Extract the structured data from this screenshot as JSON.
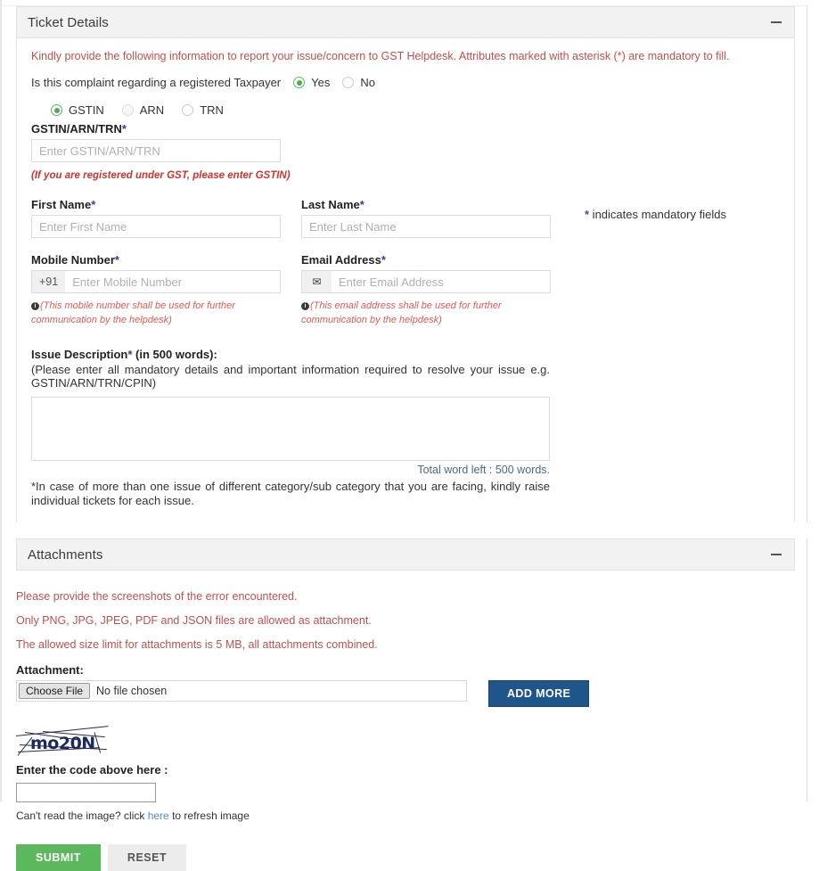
{
  "panels": {
    "ticket": {
      "title": "Ticket Details",
      "collapse_icon": "minus-icon",
      "intro": "Kindly provide the following information to report your issue/concern to GST Helpdesk. Attributes marked with asterisk (*) are mandatory to fill.",
      "registered_question": "Is this complaint regarding a registered Taxpayer",
      "registered_options": [
        {
          "label": "Yes",
          "checked": true
        },
        {
          "label": "No",
          "checked": false
        }
      ],
      "id_type_options": [
        {
          "label": "GSTIN",
          "checked": true,
          "dim": false
        },
        {
          "label": "ARN",
          "checked": false,
          "dim": true
        },
        {
          "label": "TRN",
          "checked": false,
          "dim": false
        }
      ],
      "gstin": {
        "label": "GSTIN/ARN/TRN",
        "asterisk": "*",
        "placeholder": "Enter GSTIN/ARN/TRN",
        "value": "",
        "hint": "(If you are registered under GST, please enter GSTIN)"
      },
      "first_name": {
        "label": "First Name",
        "asterisk": "*",
        "placeholder": "Enter First Name",
        "value": ""
      },
      "last_name": {
        "label": "Last Name",
        "asterisk": "*",
        "placeholder": "Enter Last Name",
        "value": ""
      },
      "mobile": {
        "label": "Mobile Number",
        "asterisk": "*",
        "prefix": "+91",
        "placeholder": "Enter Mobile Number",
        "value": "",
        "hint": "(This mobile number shall be used for further communication by the helpdesk)"
      },
      "email": {
        "label": "Email Address",
        "asterisk": "*",
        "icon": "envelope-icon",
        "placeholder": "Enter Email Address",
        "value": "",
        "hint": "(This email address shall be used for further communication by the helpdesk)"
      },
      "issue": {
        "label": "Issue Description",
        "asterisk": "*",
        "label_suffix": " (in 500 words):",
        "sub_text": "(Please enter all mandatory details and important information required to resolve your issue e.g. GSTIN/ARN/TRN/CPIN)",
        "value": "",
        "placeholder": "",
        "word_left": "Total word left : 500 words.",
        "footnote": "*In case of more than one issue of different category/sub category that you are facing, kindly raise individual tickets for each issue."
      },
      "mandatory_note_asterisk": "*",
      "mandatory_note": " indicates mandatory fields"
    },
    "attachments": {
      "title": "Attachments",
      "collapse_icon": "minus-icon",
      "lines": [
        "Please provide the screenshots of the error encountered.",
        "Only PNG, JPG, JPEG, PDF and JSON files are allowed as attachment.",
        "The allowed size limit for attachments is 5 MB, all attachments combined."
      ],
      "attachment_label": "Attachment:",
      "choose_file_button": "Choose File",
      "file_status": "No file chosen",
      "add_more_button": "ADD MORE"
    }
  },
  "captcha": {
    "image_text": "mo20N",
    "label": "Enter the code above here :",
    "input_value": "",
    "input_placeholder": "",
    "refresh_prefix": "Can't read the image? click ",
    "refresh_link": "here",
    "refresh_suffix": " to refresh image"
  },
  "actions": {
    "submit": "SUBMIT",
    "reset": "RESET"
  },
  "colors": {
    "accent_green": "#5cb85c",
    "accent_blue": "#1f5588",
    "note_red": "#c0504d",
    "hint_red": "#e05c54",
    "panel_header_bg": "#f2f2f2",
    "captcha_ink": "#1c2a63"
  }
}
